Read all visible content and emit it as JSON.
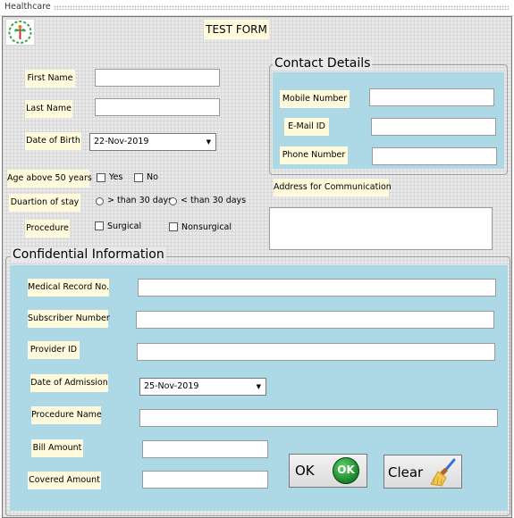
{
  "window": {
    "title": "Healthcare"
  },
  "form": {
    "title": "TEST FORM"
  },
  "personal": {
    "first_name_label": "First Name",
    "last_name_label": "Last Name",
    "dob_label": "Date of Birth",
    "dob_value": "22-Nov-2019",
    "age_label": "Age above 50 years",
    "age_yes": "Yes",
    "age_no": "No",
    "stay_label": "Duartion of stay",
    "stay_more": "> than 30 days",
    "stay_less": "< than 30 days",
    "procedure_label": "Procedure",
    "proc_surgical": "Surgical",
    "proc_nonsurgical": "Nonsurgical"
  },
  "contact": {
    "title": "Contact Details",
    "mobile_label": "Mobile Number",
    "email_label": "E-Mail ID",
    "phone_label": "Phone Number",
    "address_label": "Address for Communication"
  },
  "confidential": {
    "title": "Confidential Information",
    "medical_label": "Medical Record No.",
    "subscriber_label": "Subscriber Number",
    "provider_label": "Provider ID",
    "admission_label": "Date of Admission",
    "admission_value": "25-Nov-2019",
    "procedure_name_label": "Procedure Name",
    "bill_label": "Bill Amount",
    "covered_label": "Covered Amount"
  },
  "buttons": {
    "ok_label": "OK",
    "ok_badge": "OK",
    "clear_label": "Clear"
  },
  "colors": {
    "panel": "#add8e6",
    "label_bg": "#fffadc",
    "ok_green": "#1f8a2e"
  },
  "icons": [
    "logo-icon",
    "ok-icon",
    "broom-icon",
    "dropdown-arrow-icon"
  ]
}
